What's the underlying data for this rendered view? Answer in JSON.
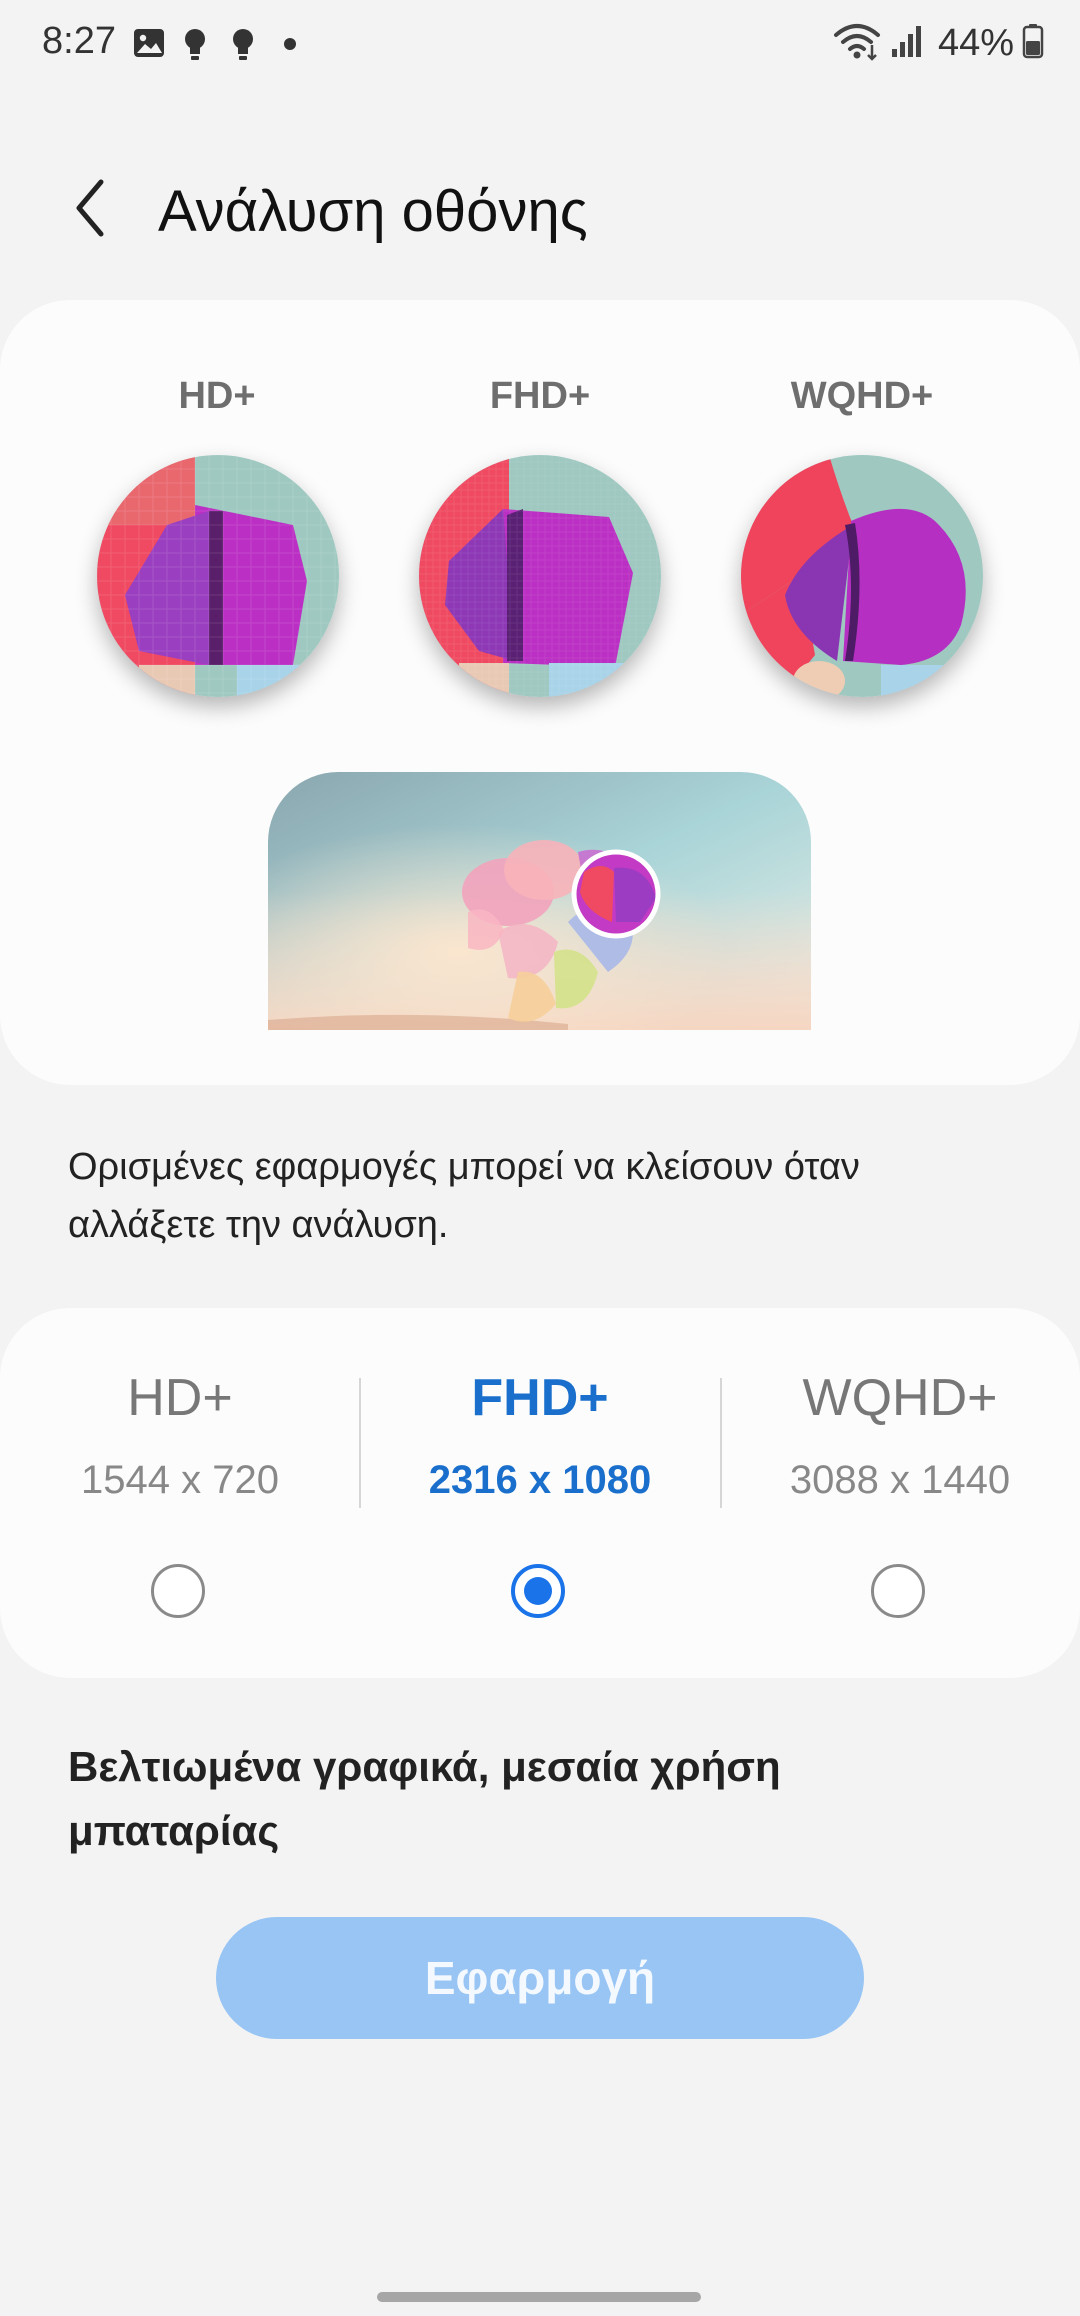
{
  "status_bar": {
    "time": "8:27",
    "left_icons": [
      "gallery-icon",
      "bulb-icon",
      "bulb-icon",
      "dot-icon"
    ],
    "right_icons": [
      "wifi-icon",
      "signal-icon",
      "battery-icon"
    ],
    "battery_text": "44%"
  },
  "header": {
    "back_icon": "chevron-left-icon",
    "title": "Ανάλυση οθόνης"
  },
  "preview": {
    "labels": [
      "HD+",
      "FHD+",
      "WQHD+"
    ]
  },
  "note": "Ορισμένες εφαρμογές μπορεί να κλείσουν όταν αλλάξετε την ανάλυση.",
  "options": [
    {
      "name": "HD+",
      "size": "1544 x 720",
      "selected": false
    },
    {
      "name": "FHD+",
      "size": "2316 x 1080",
      "selected": true
    },
    {
      "name": "WQHD+",
      "size": "3088 x 1440",
      "selected": false
    }
  ],
  "description": "Βελτιωμένα γραφικά, μεσαία χρήση μπαταρίας",
  "apply_label": "Εφαρμογή",
  "colors": {
    "accent": "#1a73e8",
    "selected_text": "#1a6fcc",
    "apply_button_disabled": "#98c5f4",
    "background": "#f3f3f3",
    "card": "#fcfcfc"
  }
}
